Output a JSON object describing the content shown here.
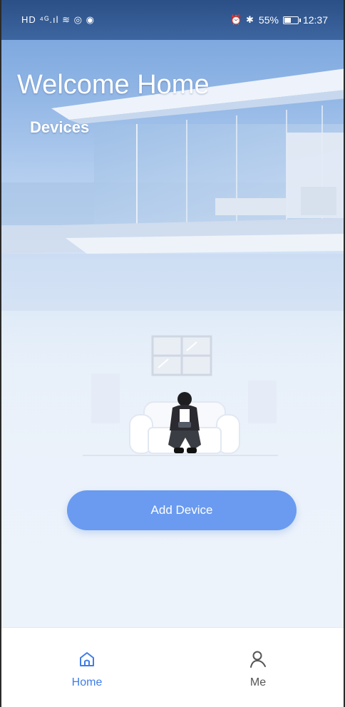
{
  "status_bar": {
    "left_glyphs": "HD ⁴ᴳ.ıl ≋ ◎ ◉",
    "right_glyphs": "⏰ ✱",
    "battery_text": "55%",
    "battery_level": 0.55,
    "time": "12:37"
  },
  "hero": {
    "title": "Welcome Home",
    "subtitle": "Devices"
  },
  "main": {
    "add_device_label": "Add Device"
  },
  "bottom_nav": {
    "items": [
      {
        "label": "Home",
        "icon": "home-icon",
        "active": true
      },
      {
        "label": "Me",
        "icon": "person-icon",
        "active": false
      }
    ]
  },
  "colors": {
    "accent": "#3f7de8",
    "button": "#6a9bf0",
    "statusbar": "#2b4f86"
  }
}
